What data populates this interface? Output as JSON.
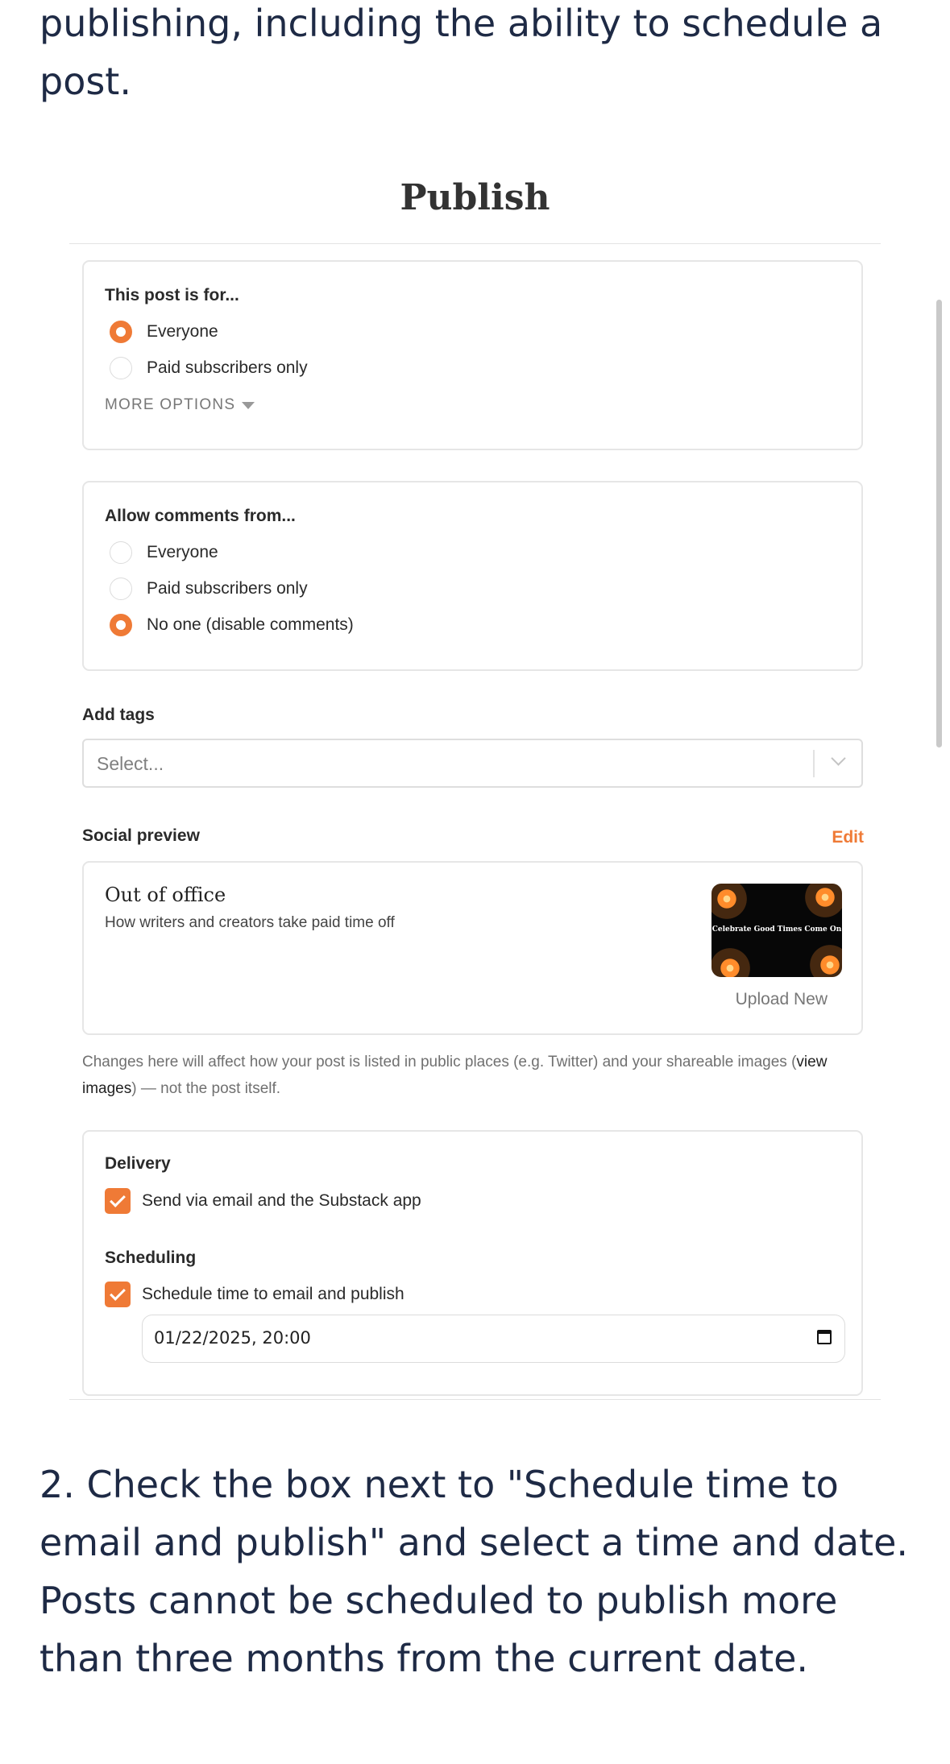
{
  "article": {
    "intro_text": "publishing, including the ability to schedule a post.",
    "step_text": "2. Check the box next to \"Schedule time to email and publish\" and select a time and date. Posts cannot be scheduled to publish more than three months from the current date."
  },
  "publish": {
    "title": "Publish",
    "audience": {
      "title": "This post is for...",
      "options": [
        {
          "label": "Everyone",
          "checked": true
        },
        {
          "label": "Paid subscribers only",
          "checked": false
        }
      ],
      "more_options": "MORE OPTIONS"
    },
    "comments": {
      "title": "Allow comments from...",
      "options": [
        {
          "label": "Everyone",
          "checked": false
        },
        {
          "label": "Paid subscribers only",
          "checked": false
        },
        {
          "label": "No one (disable comments)",
          "checked": true
        }
      ]
    },
    "tags": {
      "label": "Add tags",
      "placeholder": "Select..."
    },
    "social": {
      "label": "Social preview",
      "edit": "Edit",
      "post_title": "Out of office",
      "post_subtitle": "How writers and creators take paid time off",
      "image_text": "Celebrate Good Times Come On",
      "upload": "Upload New",
      "helper_before": "Changes here will affect how your post is listed in public places (e.g. Twitter) and your shareable images (",
      "helper_link": "view images",
      "helper_after": ") — not the post itself."
    },
    "delivery": {
      "title": "Delivery",
      "email_label": "Send via email and the Substack app",
      "email_checked": true,
      "scheduling_title": "Scheduling",
      "schedule_label": "Schedule time to email and publish",
      "schedule_checked": true,
      "datetime": "01/22/2025, 20:00"
    }
  },
  "colors": {
    "accent": "#ef7a36",
    "article_text": "#1e2a45"
  }
}
